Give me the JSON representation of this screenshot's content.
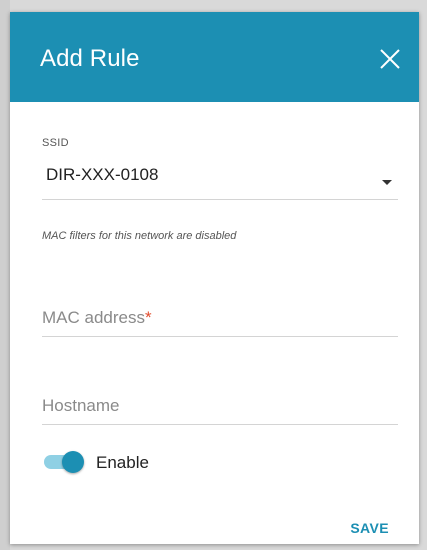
{
  "dialog": {
    "title": "Add Rule",
    "close_icon": "close-icon"
  },
  "ssid": {
    "label": "SSID",
    "value": "DIR-XXX-0108",
    "caret_icon": "caret-down-icon"
  },
  "hint": "MAC filters for this network are disabled",
  "mac_address": {
    "placeholder": "MAC address",
    "required_marker": "*",
    "value": ""
  },
  "hostname": {
    "placeholder": "Hostname",
    "value": ""
  },
  "enable": {
    "label": "Enable",
    "checked": true
  },
  "actions": {
    "save_label": "SAVE"
  },
  "colors": {
    "accent": "#1c8fb3",
    "toggle_track": "#8fd0e4",
    "required": "#e14b2c"
  }
}
